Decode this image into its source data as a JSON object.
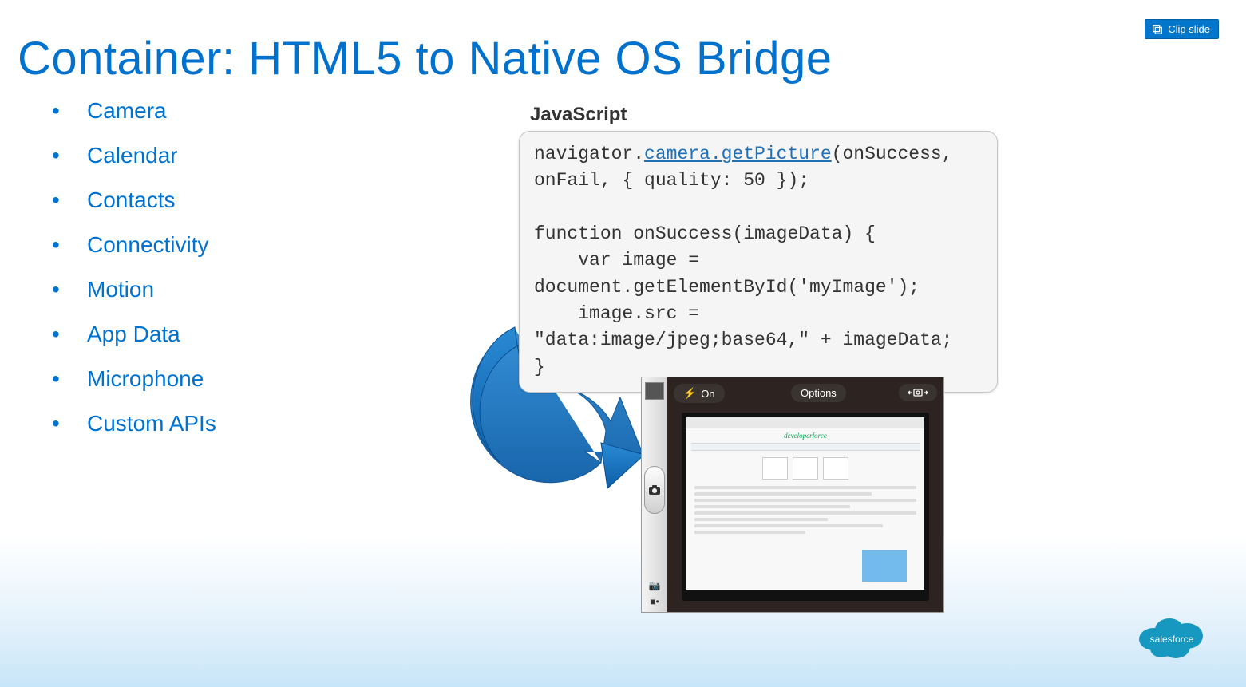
{
  "clip_button": "Clip slide",
  "title": "Container: HTML5 to Native OS Bridge",
  "bullets": [
    "Camera",
    "Calendar",
    "Contacts",
    "Connectivity",
    "Motion",
    "App Data",
    "Microphone",
    "Custom APIs"
  ],
  "code": {
    "heading": "JavaScript",
    "line1_a": "navigator.",
    "line1_u": "camera.getPicture",
    "line1_b": "(onSuccess, onFail, { quality: 50 });",
    "rest": "\n\nfunction onSuccess(imageData) {\n    var image = document.getElementById('myImage');\n    image.src = \"data:image/jpeg;base64,\" + imageData;\n}"
  },
  "camera_ui": {
    "flash_label": "On",
    "options_label": "Options",
    "screen_brand": "developerforce"
  },
  "brand": "salesforce",
  "colors": {
    "accent": "#0072ce"
  }
}
